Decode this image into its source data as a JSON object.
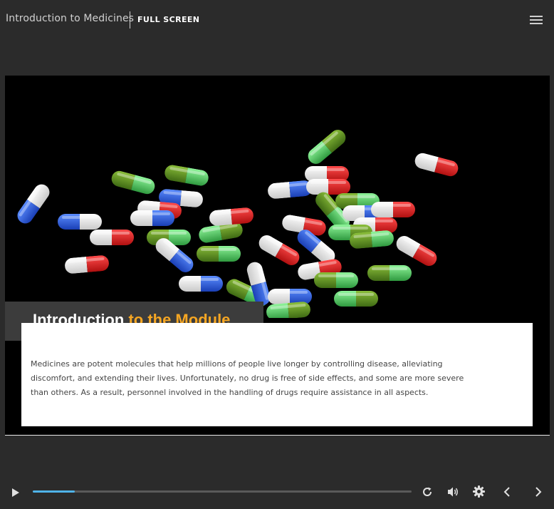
{
  "header": {
    "course_title": "Introduction to Medicines",
    "fullscreen_label": "FULL SCREEN",
    "menu_icon": "hamburger-menu-icon"
  },
  "slide": {
    "heading_part1": "Introduction",
    "heading_part2": "to the Module",
    "body": "Medicines are potent molecules that help millions of people live longer by controlling disease, alleviating discomfort, and extending their lives. Unfortunately, no drug is free of side effects, and some are more severe than others. As a result, personnel involved in the handling of drugs require assistance in all aspects.",
    "image": "capsules-on-black-background",
    "accent_color": "#f5a623"
  },
  "player": {
    "progress": 0.11,
    "progress_color": "#4fb3e8",
    "controls": [
      "play-icon",
      "replay-icon",
      "volume-icon",
      "settings-icon",
      "previous-icon",
      "next-icon"
    ]
  }
}
